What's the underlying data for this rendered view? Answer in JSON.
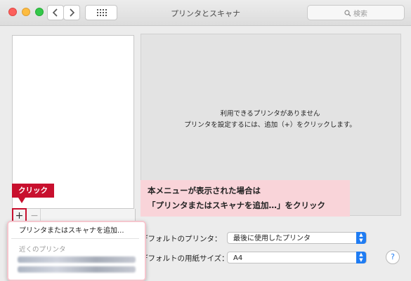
{
  "window": {
    "title": "プリンタとスキャナ"
  },
  "search": {
    "placeholder": "検索"
  },
  "detail": {
    "line1": "利用できるプリンタがありません",
    "line2": "プリンタを設定するには、追加（+）をクリックします。"
  },
  "list": {
    "add_symbol": "+",
    "remove_symbol": "−"
  },
  "annotation": {
    "click_label": "クリック",
    "note_line1": "本メニューが表示された場合は",
    "note_line2": "「プリンタまたはスキャナを追加…」をクリック"
  },
  "popup": {
    "item_add": "プリンタまたはスキャナを追加...",
    "nearby_header": "近くのプリンタ"
  },
  "settings": {
    "default_printer_label": "デフォルトのプリンタ：",
    "default_printer_value": "最後に使用したプリンタ",
    "default_paper_label": "デフォルトの用紙サイズ：",
    "default_paper_value": "A4"
  },
  "help": {
    "symbol": "?"
  },
  "colors": {
    "accent": "#1f7cf3",
    "callout_red": "#c8102e",
    "callout_pink": "#f9d4d9"
  },
  "icons": [
    "close-icon",
    "minimize-icon",
    "zoom-icon",
    "back-icon",
    "forward-icon",
    "grid-icon",
    "search-icon",
    "help-icon"
  ]
}
